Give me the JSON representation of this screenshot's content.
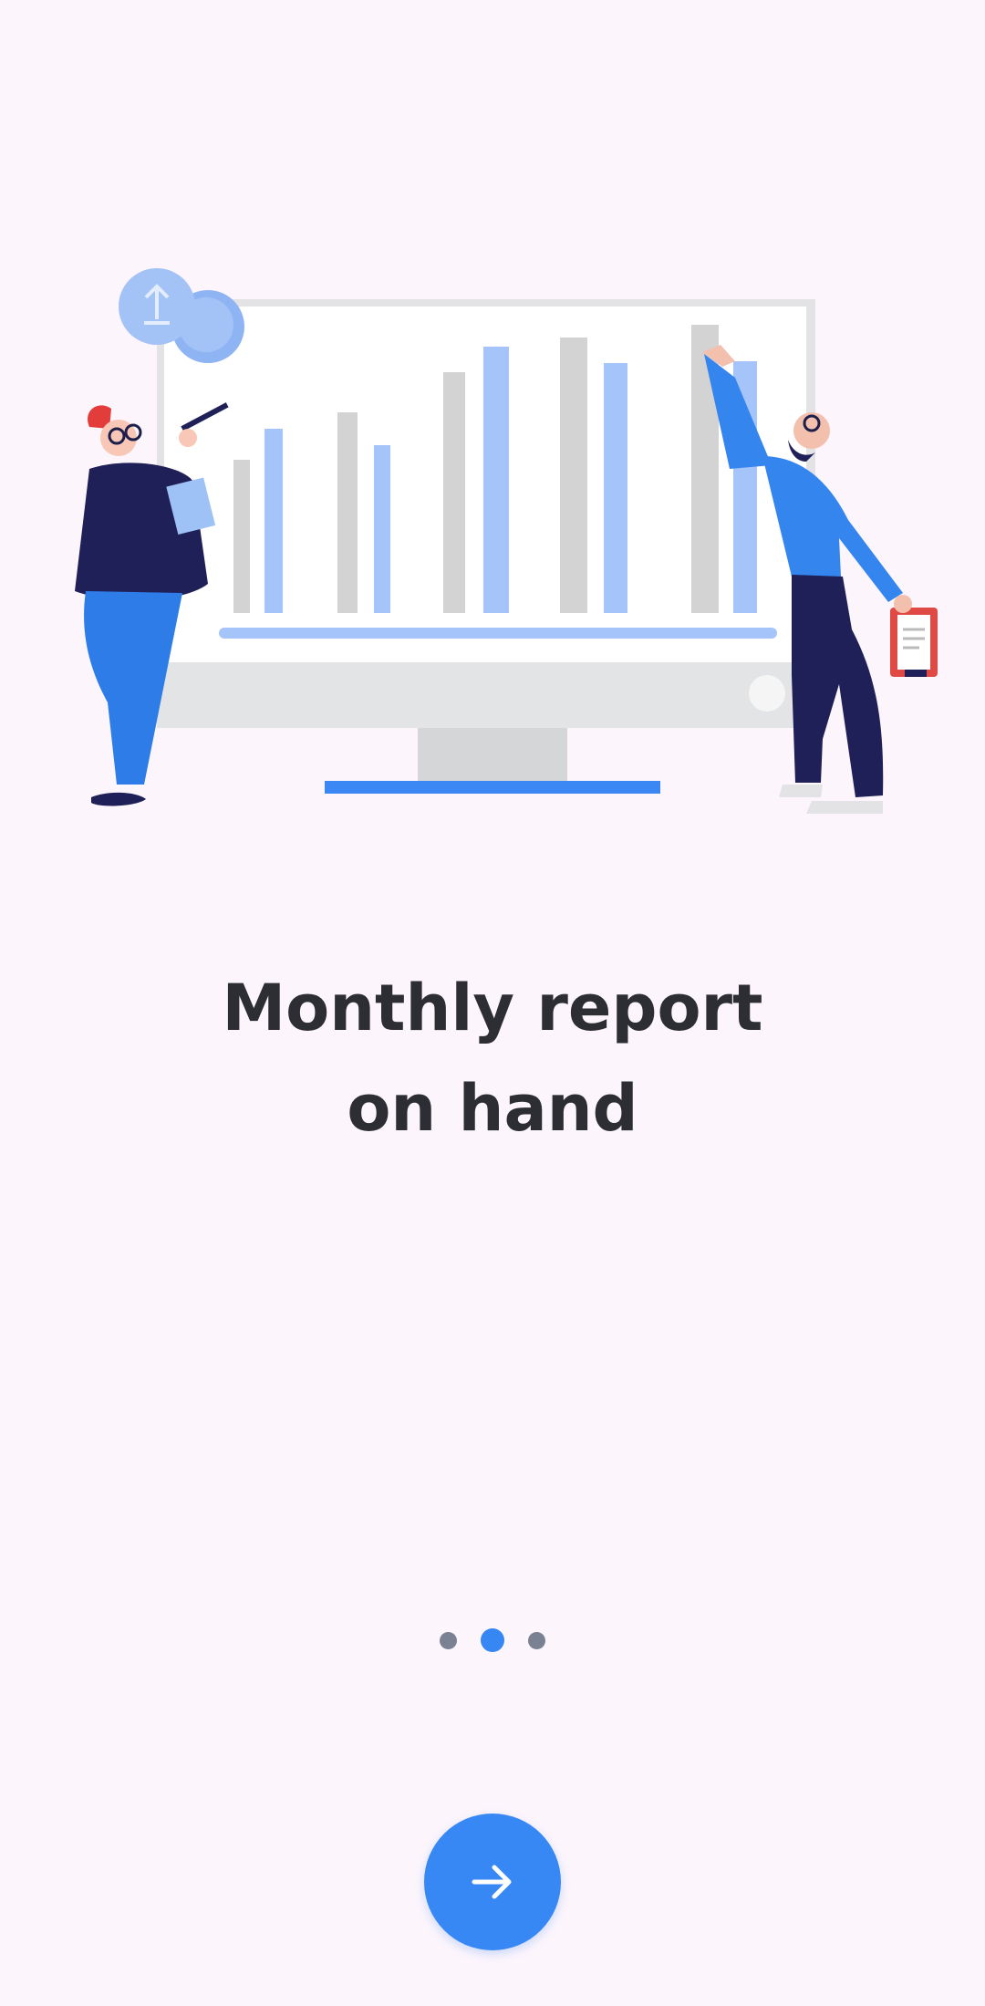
{
  "onboarding": {
    "headline_line1": "Monthly report",
    "headline_line2": "on hand",
    "page_count": 3,
    "current_page": 2,
    "next_button": {
      "icon": "arrow-right-icon"
    }
  },
  "illustration": {
    "name": "monthly-report-illustration",
    "icons": [
      "coin-icon",
      "person-woman-with-pen",
      "person-man-with-clipboard",
      "monitor"
    ]
  },
  "colors": {
    "background": "#fcf5fc",
    "accent": "#3686f4",
    "text": "#2d2e33",
    "dot_inactive": "#7a8193"
  }
}
